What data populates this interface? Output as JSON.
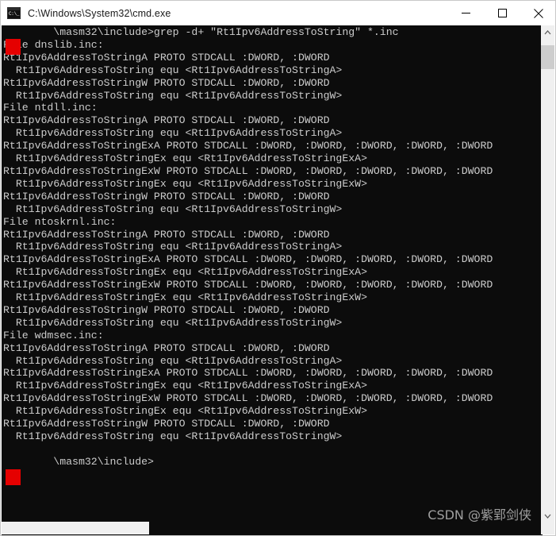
{
  "window": {
    "title": "C:\\Windows\\System32\\cmd.exe",
    "icon": "cmd-console-icon",
    "icon_glyph": "C:\\_",
    "controls": {
      "minimize_label": "Minimize",
      "maximize_label": "Maximize",
      "close_label": "Close"
    },
    "colors": {
      "titlebar_bg": "#ffffff",
      "console_bg": "#0c0c0c",
      "console_fg": "#cccccc",
      "redaction": "#e50000",
      "scrollbar_track": "#f0f0f0",
      "scrollbar_thumb": "#cdcdcd"
    }
  },
  "console": {
    "prompt_1": "        \\masm32\\include>grep -d+ \"Rt1Ipv6AddressToString\" *.inc",
    "prompt_2": "        \\masm32\\include>",
    "lines": [
      "        \\masm32\\include>grep -d+ \"Rt1Ipv6AddressToString\" *.inc",
      "File dnslib.inc:",
      "Rt1Ipv6AddressToStringA PROTO STDCALL :DWORD, :DWORD",
      "  Rt1Ipv6AddressToString equ <Rt1Ipv6AddressToStringA>",
      "Rt1Ipv6AddressToStringW PROTO STDCALL :DWORD, :DWORD",
      "  Rt1Ipv6AddressToString equ <Rt1Ipv6AddressToStringW>",
      "File ntdll.inc:",
      "Rt1Ipv6AddressToStringA PROTO STDCALL :DWORD, :DWORD",
      "  Rt1Ipv6AddressToString equ <Rt1Ipv6AddressToStringA>",
      "Rt1Ipv6AddressToStringExA PROTO STDCALL :DWORD, :DWORD, :DWORD, :DWORD, :DWORD",
      "  Rt1Ipv6AddressToStringEx equ <Rt1Ipv6AddressToStringExA>",
      "Rt1Ipv6AddressToStringExW PROTO STDCALL :DWORD, :DWORD, :DWORD, :DWORD, :DWORD",
      "  Rt1Ipv6AddressToStringEx equ <Rt1Ipv6AddressToStringExW>",
      "Rt1Ipv6AddressToStringW PROTO STDCALL :DWORD, :DWORD",
      "  Rt1Ipv6AddressToString equ <Rt1Ipv6AddressToStringW>",
      "File ntoskrnl.inc:",
      "Rt1Ipv6AddressToStringA PROTO STDCALL :DWORD, :DWORD",
      "  Rt1Ipv6AddressToString equ <Rt1Ipv6AddressToStringA>",
      "Rt1Ipv6AddressToStringExA PROTO STDCALL :DWORD, :DWORD, :DWORD, :DWORD, :DWORD",
      "  Rt1Ipv6AddressToStringEx equ <Rt1Ipv6AddressToStringExA>",
      "Rt1Ipv6AddressToStringExW PROTO STDCALL :DWORD, :DWORD, :DWORD, :DWORD, :DWORD",
      "  Rt1Ipv6AddressToStringEx equ <Rt1Ipv6AddressToStringExW>",
      "Rt1Ipv6AddressToStringW PROTO STDCALL :DWORD, :DWORD",
      "  Rt1Ipv6AddressToString equ <Rt1Ipv6AddressToStringW>",
      "File wdmsec.inc:",
      "Rt1Ipv6AddressToStringA PROTO STDCALL :DWORD, :DWORD",
      "  Rt1Ipv6AddressToString equ <Rt1Ipv6AddressToStringA>",
      "Rt1Ipv6AddressToStringExA PROTO STDCALL :DWORD, :DWORD, :DWORD, :DWORD, :DWORD",
      "  Rt1Ipv6AddressToStringEx equ <Rt1Ipv6AddressToStringExA>",
      "Rt1Ipv6AddressToStringExW PROTO STDCALL :DWORD, :DWORD, :DWORD, :DWORD, :DWORD",
      "  Rt1Ipv6AddressToStringEx equ <Rt1Ipv6AddressToStringExW>",
      "Rt1Ipv6AddressToStringW PROTO STDCALL :DWORD, :DWORD",
      "  Rt1Ipv6AddressToString equ <Rt1Ipv6AddressToStringW>",
      "",
      "        \\masm32\\include>"
    ],
    "command": "grep -d+ \"Rt1Ipv6AddressToString\" *.inc",
    "files_matched": [
      "dnslib.inc",
      "ntdll.inc",
      "ntoskrnl.inc",
      "wdmsec.inc"
    ]
  },
  "watermark": {
    "text": "CSDN @紫郢剑侠"
  },
  "scrollbars": {
    "vertical": {
      "up_arrow": "chevron-up-icon",
      "down_arrow": "chevron-down-icon"
    },
    "horizontal": {
      "thumb_label": "horizontal-scroll-thumb"
    }
  }
}
